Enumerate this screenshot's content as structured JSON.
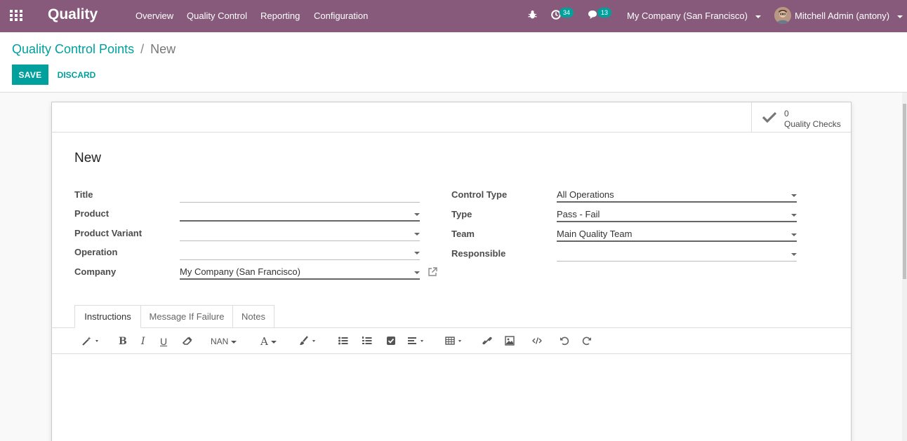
{
  "navbar": {
    "app_name": "Quality",
    "menu": [
      "Overview",
      "Quality Control",
      "Reporting",
      "Configuration"
    ],
    "activity_count": "34",
    "messages_count": "13",
    "company": "My Company (San Francisco)",
    "user": "Mitchell Admin (antony)",
    "color": "#875a7b"
  },
  "breadcrumb": {
    "parent": "Quality Control Points",
    "separator": "/",
    "current": "New"
  },
  "actions": {
    "save": "SAVE",
    "discard": "DISCARD"
  },
  "stat_button": {
    "value": "0",
    "label": "Quality Checks"
  },
  "record": {
    "title": "New"
  },
  "fields_left": [
    {
      "label": "Title",
      "value": ""
    },
    {
      "label": "Product",
      "value": ""
    },
    {
      "label": "Product Variant",
      "value": ""
    },
    {
      "label": "Operation",
      "value": ""
    },
    {
      "label": "Company",
      "value": "My Company (San Francisco)"
    }
  ],
  "fields_right": [
    {
      "label": "Control Type",
      "value": "All Operations"
    },
    {
      "label": "Type",
      "value": "Pass - Fail"
    },
    {
      "label": "Team",
      "value": "Main Quality Team"
    },
    {
      "label": "Responsible",
      "value": ""
    }
  ],
  "tabs": [
    "Instructions",
    "Message If Failure",
    "Notes"
  ],
  "editor": {
    "font_size": "NAN",
    "icons": [
      "magic-wand-icon",
      "bold-icon",
      "italic-icon",
      "underline-icon",
      "eraser-icon",
      "font-size-dropdown",
      "font-color-icon",
      "paint-brush-icon",
      "bullet-list-icon",
      "numbered-list-icon",
      "checklist-icon",
      "align-icon",
      "table-icon",
      "link-icon",
      "image-icon",
      "code-view-icon",
      "undo-icon",
      "redo-icon"
    ]
  },
  "accent_color": "#00a09d"
}
